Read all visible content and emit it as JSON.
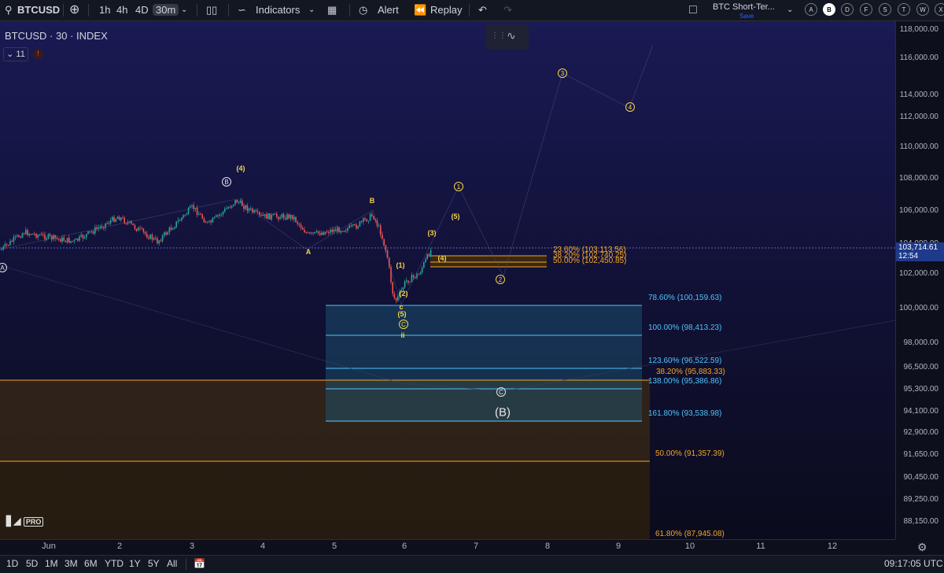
{
  "toolbar": {
    "symbol": "BTCUSD",
    "timeframes": [
      "1h",
      "4h",
      "4D",
      "30m"
    ],
    "active_timeframe": "30m",
    "indicators_label": "Indicators",
    "alert_label": "Alert",
    "replay_label": "Replay",
    "layout_name": "BTC Short-Ter...",
    "save_label": "Save",
    "layout_slots": [
      "A",
      "B",
      "D",
      "F",
      "S",
      "T",
      "W",
      "X"
    ],
    "active_slot": "B"
  },
  "legend": {
    "title": "BTCUSD · 30 · INDEX",
    "indicator_count": "11",
    "warning_mark": "!"
  },
  "price_axis": {
    "labels": [
      "118,000.00",
      "116,000.00",
      "114,000.00",
      "112,000.00",
      "110,000.00",
      "108,000.00",
      "106,000.00",
      "104,000.00",
      "102,000.00",
      "100,000.00",
      "98,000.00",
      "96,500.00",
      "95,300.00",
      "94,100.00",
      "92,900.00",
      "91,650.00",
      "90,450.00",
      "89,250.00",
      "88,150.00"
    ],
    "last_price": "103,714.61",
    "countdown": "12:54"
  },
  "time_axis": {
    "labels": [
      "Jun",
      "2",
      "3",
      "4",
      "5",
      "6",
      "7",
      "8",
      "9",
      "10",
      "11",
      "12"
    ]
  },
  "fib_levels": [
    {
      "label": "23.60% (103,113.56)",
      "color": "#f5a623"
    },
    {
      "label": "38.20% (102,740.25)",
      "color": "#f5a623"
    },
    {
      "label": "50.00% (102,450.85)",
      "color": "#f5a623"
    },
    {
      "label": "78.60% (100,159.63)",
      "color": "#4fc3f7"
    },
    {
      "label": "100.00% (98,413.23)",
      "color": "#4fc3f7"
    },
    {
      "label": "123.60% (96,522.59)",
      "color": "#4fc3f7"
    },
    {
      "label": "38.20% (95,883.33)",
      "color": "#f5a623"
    },
    {
      "label": "138.00% (95,386.86)",
      "color": "#4fc3f7"
    },
    {
      "label": "161.80% (93,538.98)",
      "color": "#4fc3f7"
    },
    {
      "label": "50.00% (91,357.39)",
      "color": "#f5a623"
    },
    {
      "label": "61.80% (87,945.08)",
      "color": "#f5a623"
    }
  ],
  "wave_labels": {
    "A_start": "A",
    "B_circ": "B",
    "w4_top": "(4)",
    "A_mid": "A",
    "B_mid": "B",
    "w1": "(1)",
    "w2": "(2)",
    "c_small": "c",
    "w5_low": "(5)",
    "C_circ": "C",
    "ii": "ii",
    "w3": "(3)",
    "w4": "(4)",
    "w5": "(5)",
    "one": "1",
    "two": "2",
    "three": "3",
    "four": "4",
    "C_target": "C",
    "B_big": "(B)"
  },
  "logo": "PRO",
  "bottom": {
    "ranges": [
      "1D",
      "5D",
      "1M",
      "3M",
      "6M",
      "YTD",
      "1Y",
      "5Y",
      "All"
    ],
    "clock": "09:17:05 UTC"
  },
  "colors": {
    "up": "#26a69a",
    "down": "#ef5350",
    "fib_orange": "#f5a623",
    "fib_blue": "#4fc3f7",
    "wave": "#f5d547"
  }
}
